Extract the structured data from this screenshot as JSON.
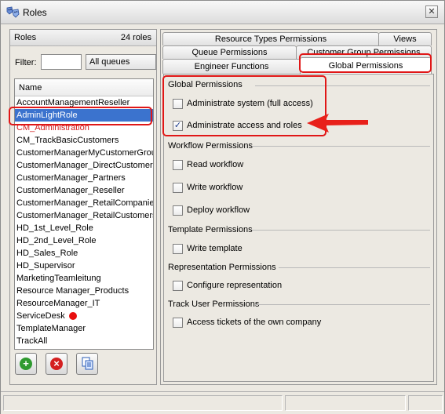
{
  "window": {
    "title": "Roles",
    "icon": "roles-icon",
    "close_icon": "close-icon"
  },
  "left": {
    "header_title": "Roles",
    "count": "24 roles",
    "filter_label": "Filter:",
    "filter_value": "",
    "queue_select": "All queues",
    "column_header": "Name",
    "items": [
      "AccountManagementReseller",
      "AdminLightRole",
      "CM_Administration",
      "CM_TrackBasicCustomers",
      "CustomerManagerMyCustomerGroup",
      "CustomerManager_DirectCustomers",
      "CustomerManager_Partners",
      "CustomerManager_Reseller",
      "CustomerManager_RetailCompanies",
      "CustomerManager_RetailCustomers",
      "HD_1st_Level_Role",
      "HD_2nd_Level_Role",
      "HD_Sales_Role",
      "HD_Supervisor",
      "MarketingTeamleitung",
      "Resource Manager_Products",
      "ResourceManager_IT",
      "ServiceDesk",
      "TemplateManager",
      "TrackAll"
    ],
    "selected_item": "AdminLightRole",
    "red_item": "CM_Administration",
    "buttons": {
      "add": "add-icon",
      "delete": "delete-icon",
      "copy": "copy-icon"
    }
  },
  "tabs": {
    "row1": [
      "Resource Types Permissions",
      "Views"
    ],
    "row2": [
      "Queue Permissions",
      "Customer Group Permissions"
    ],
    "row3": [
      "Engineer Functions",
      "Global Permissions"
    ],
    "active": "Global Permissions"
  },
  "sections": [
    {
      "title": "Global Permissions",
      "items": [
        {
          "label": "Administrate system (full access)",
          "checked": false
        },
        {
          "label": "Administrate access and roles",
          "checked": true
        }
      ]
    },
    {
      "title": "Workflow Permissions",
      "items": [
        {
          "label": "Read workflow",
          "checked": false
        },
        {
          "label": "Write workflow",
          "checked": false
        },
        {
          "label": "Deploy workflow",
          "checked": false
        }
      ]
    },
    {
      "title": "Template Permissions",
      "items": [
        {
          "label": "Write template",
          "checked": false
        }
      ]
    },
    {
      "title": "Representation Permissions",
      "items": [
        {
          "label": "Configure representation",
          "checked": false
        }
      ]
    },
    {
      "title": "Track User Permissions",
      "items": [
        {
          "label": "Access tickets of the own company",
          "checked": false
        }
      ]
    }
  ],
  "colors": {
    "selection": "#3b73ce",
    "annotation_red": "#e01717",
    "text_red": "#d21e1e"
  }
}
